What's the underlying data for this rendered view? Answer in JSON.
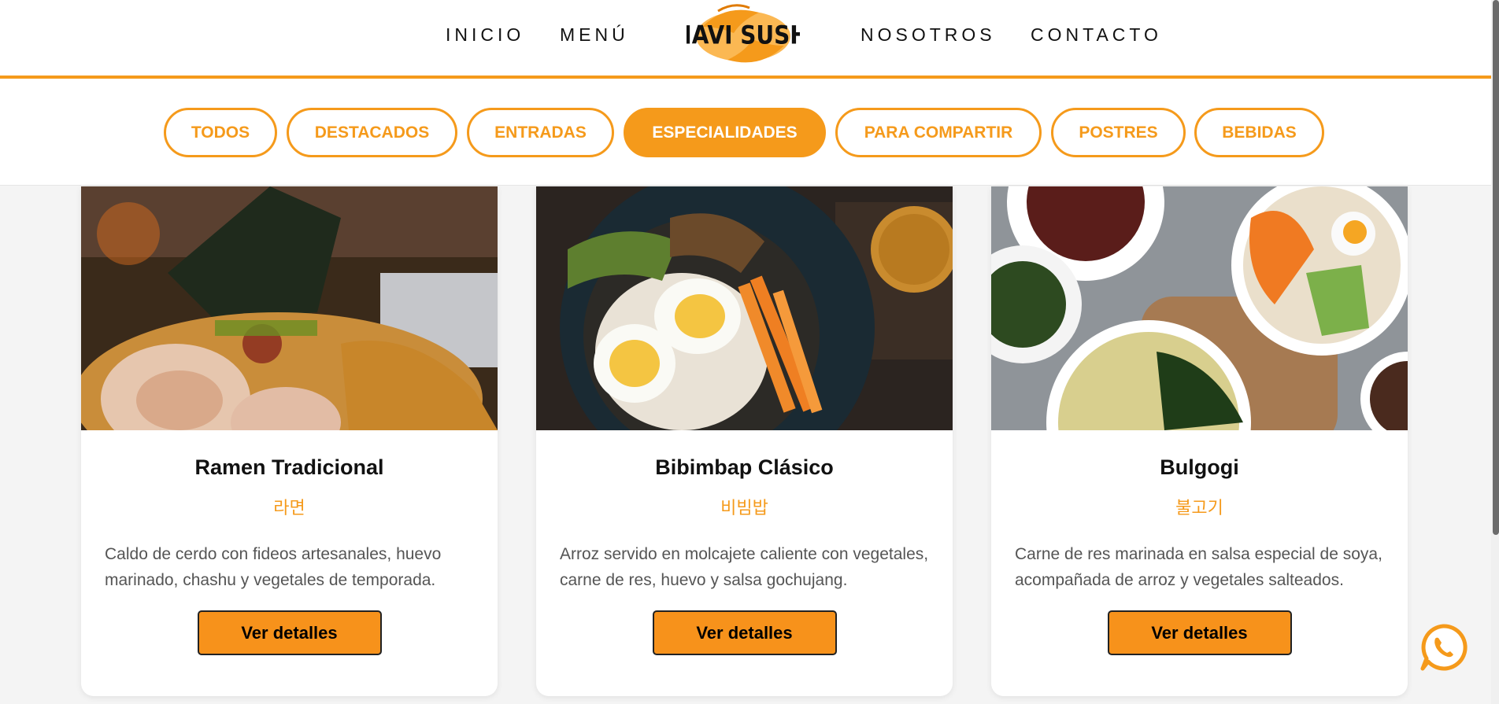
{
  "nav": {
    "links": [
      "INICIO",
      "MENÚ",
      "NOSOTROS",
      "CONTACTO"
    ],
    "logo_text": "MAVI SUSHI",
    "accent_color": "#f59a1b"
  },
  "filters": [
    {
      "label": "TODOS",
      "active": false
    },
    {
      "label": "DESTACADOS",
      "active": false
    },
    {
      "label": "ENTRADAS",
      "active": false
    },
    {
      "label": "ESPECIALIDADES",
      "active": true
    },
    {
      "label": "PARA COMPARTIR",
      "active": false
    },
    {
      "label": "POSTRES",
      "active": false
    },
    {
      "label": "BEBIDAS",
      "active": false
    }
  ],
  "cards": [
    {
      "title": "Ramen Tradicional",
      "subtitle": "라면",
      "description": "Caldo de cerdo con fideos artesanales, huevo marinado, chashu y vegetales de temporada.",
      "button": "Ver detalles",
      "image": "ramen-photo"
    },
    {
      "title": "Bibimbap Clásico",
      "subtitle": "비빔밥",
      "description": "Arroz servido en molcajete caliente con vegetales, carne de res, huevo y salsa gochujang.",
      "button": "Ver detalles",
      "image": "bibimbap-photo"
    },
    {
      "title": "Bulgogi",
      "subtitle": "불고기",
      "description": "Carne de res marinada en salsa especial de soya, acompañada de arroz y vegetales salteados.",
      "button": "Ver detalles",
      "image": "bulgogi-photo"
    }
  ],
  "floating": {
    "icon": "whatsapp-icon"
  }
}
